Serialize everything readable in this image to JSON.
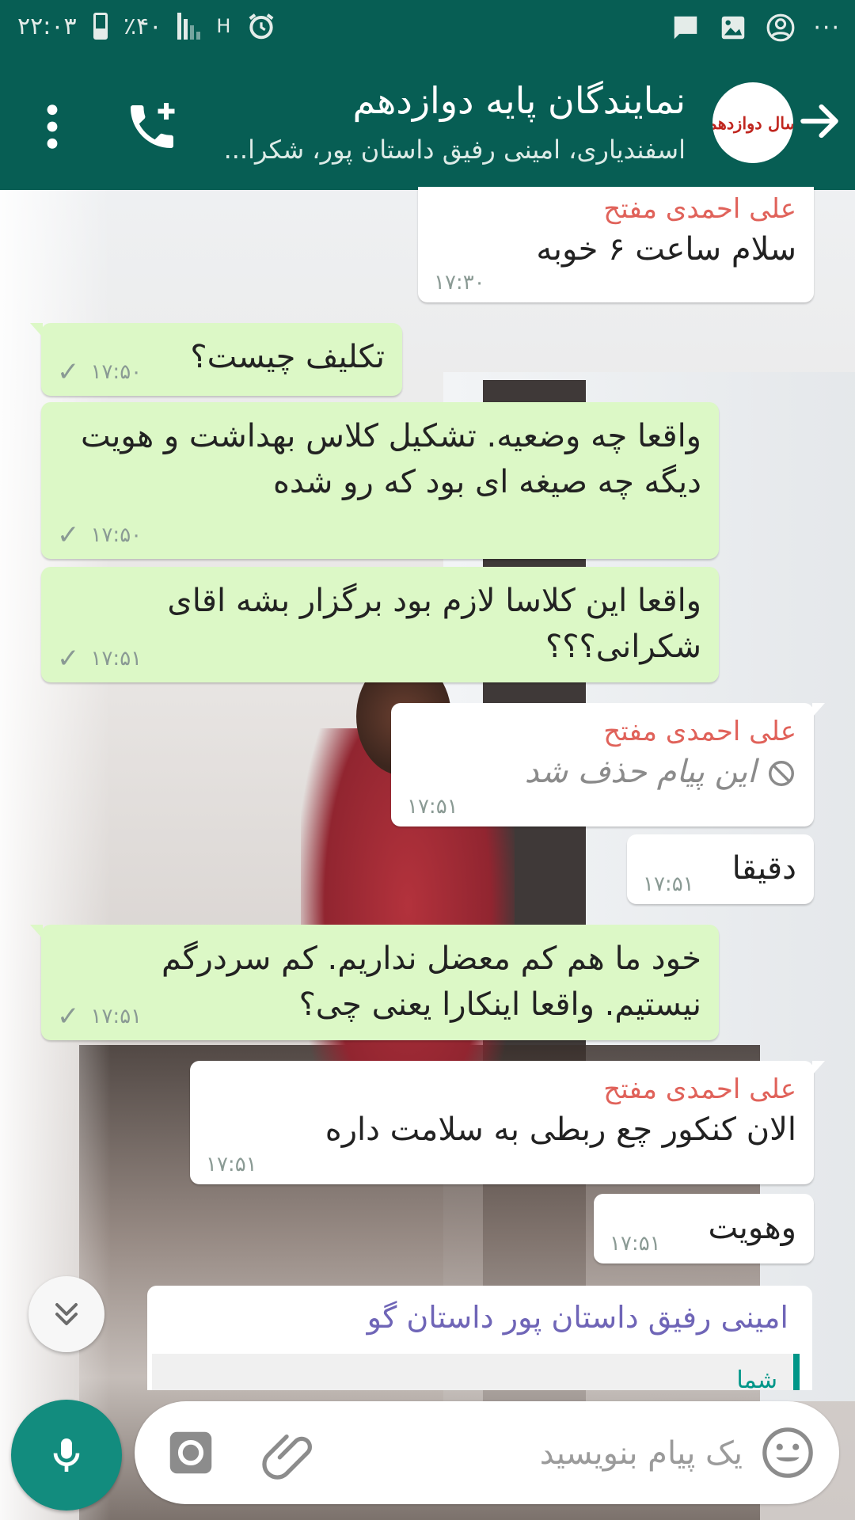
{
  "status_bar": {
    "time": "۲۲:۰۳",
    "battery": "٪۴۰",
    "network": "H",
    "icons": [
      "alarm-icon",
      "signal-icon",
      "battery-icon",
      "more-icon",
      "account-icon",
      "image-icon",
      "message-icon"
    ],
    "more": "···"
  },
  "header": {
    "title": "نمایندگان پایه دوازدهم",
    "members": "اسفندیاری، امینی رفیق داستان پور، شکرا...",
    "avatar_text": "سال دوازدهم",
    "colors": {
      "bar": "#075e54",
      "avatar_text": "#c0261f"
    }
  },
  "messages": [
    {
      "direction": "in",
      "sender": "علی احمدی مفتح",
      "text": "سلام ساعت ۶ خوبه",
      "time": "۱۷:۳۰"
    },
    {
      "direction": "out",
      "text": "تکلیف چیست؟",
      "time": "۱۷:۵۰",
      "status": "✓"
    },
    {
      "direction": "out",
      "text": "واقعا چه وضعیه. تشکیل کلاس بهداشت و هویت دیگه چه صیغه ای بود که رو شده",
      "time": "۱۷:۵۰",
      "status": "✓"
    },
    {
      "direction": "out",
      "text": "واقعا این کلاسا لازم بود برگزار بشه اقای شکرانی؟؟؟",
      "time": "۱۷:۵۱",
      "status": "✓"
    },
    {
      "direction": "in",
      "sender": "علی احمدی مفتح",
      "text": "این پیام حذف شد",
      "deleted": true,
      "time": "۱۷:۵۱"
    },
    {
      "direction": "in",
      "text": "دقیقا",
      "time": "۱۷:۵۱"
    },
    {
      "direction": "out",
      "text": "خود ما هم کم معضل نداریم. کم سردرگم نیستیم. واقعا اینکارا یعنی چی؟",
      "time": "۱۷:۵۱",
      "status": "✓"
    },
    {
      "direction": "in",
      "sender": "علی احمدی مفتح",
      "text": "الان کنکور چع ربطی به سلامت داره",
      "time": "۱۷:۵۱"
    },
    {
      "direction": "in",
      "text": "وهویت",
      "time": "۱۷:۵۱"
    }
  ],
  "quoted_message": {
    "author": "امینی رفیق داستان پور داستان گو",
    "reply_to": "شما"
  },
  "composer": {
    "placeholder": "یک پیام بنویسید"
  },
  "colors": {
    "incoming_bubble": "#ffffff",
    "outgoing_bubble": "#dcf8c6",
    "sender_name": "#e0625a",
    "accent": "#128c7e"
  }
}
